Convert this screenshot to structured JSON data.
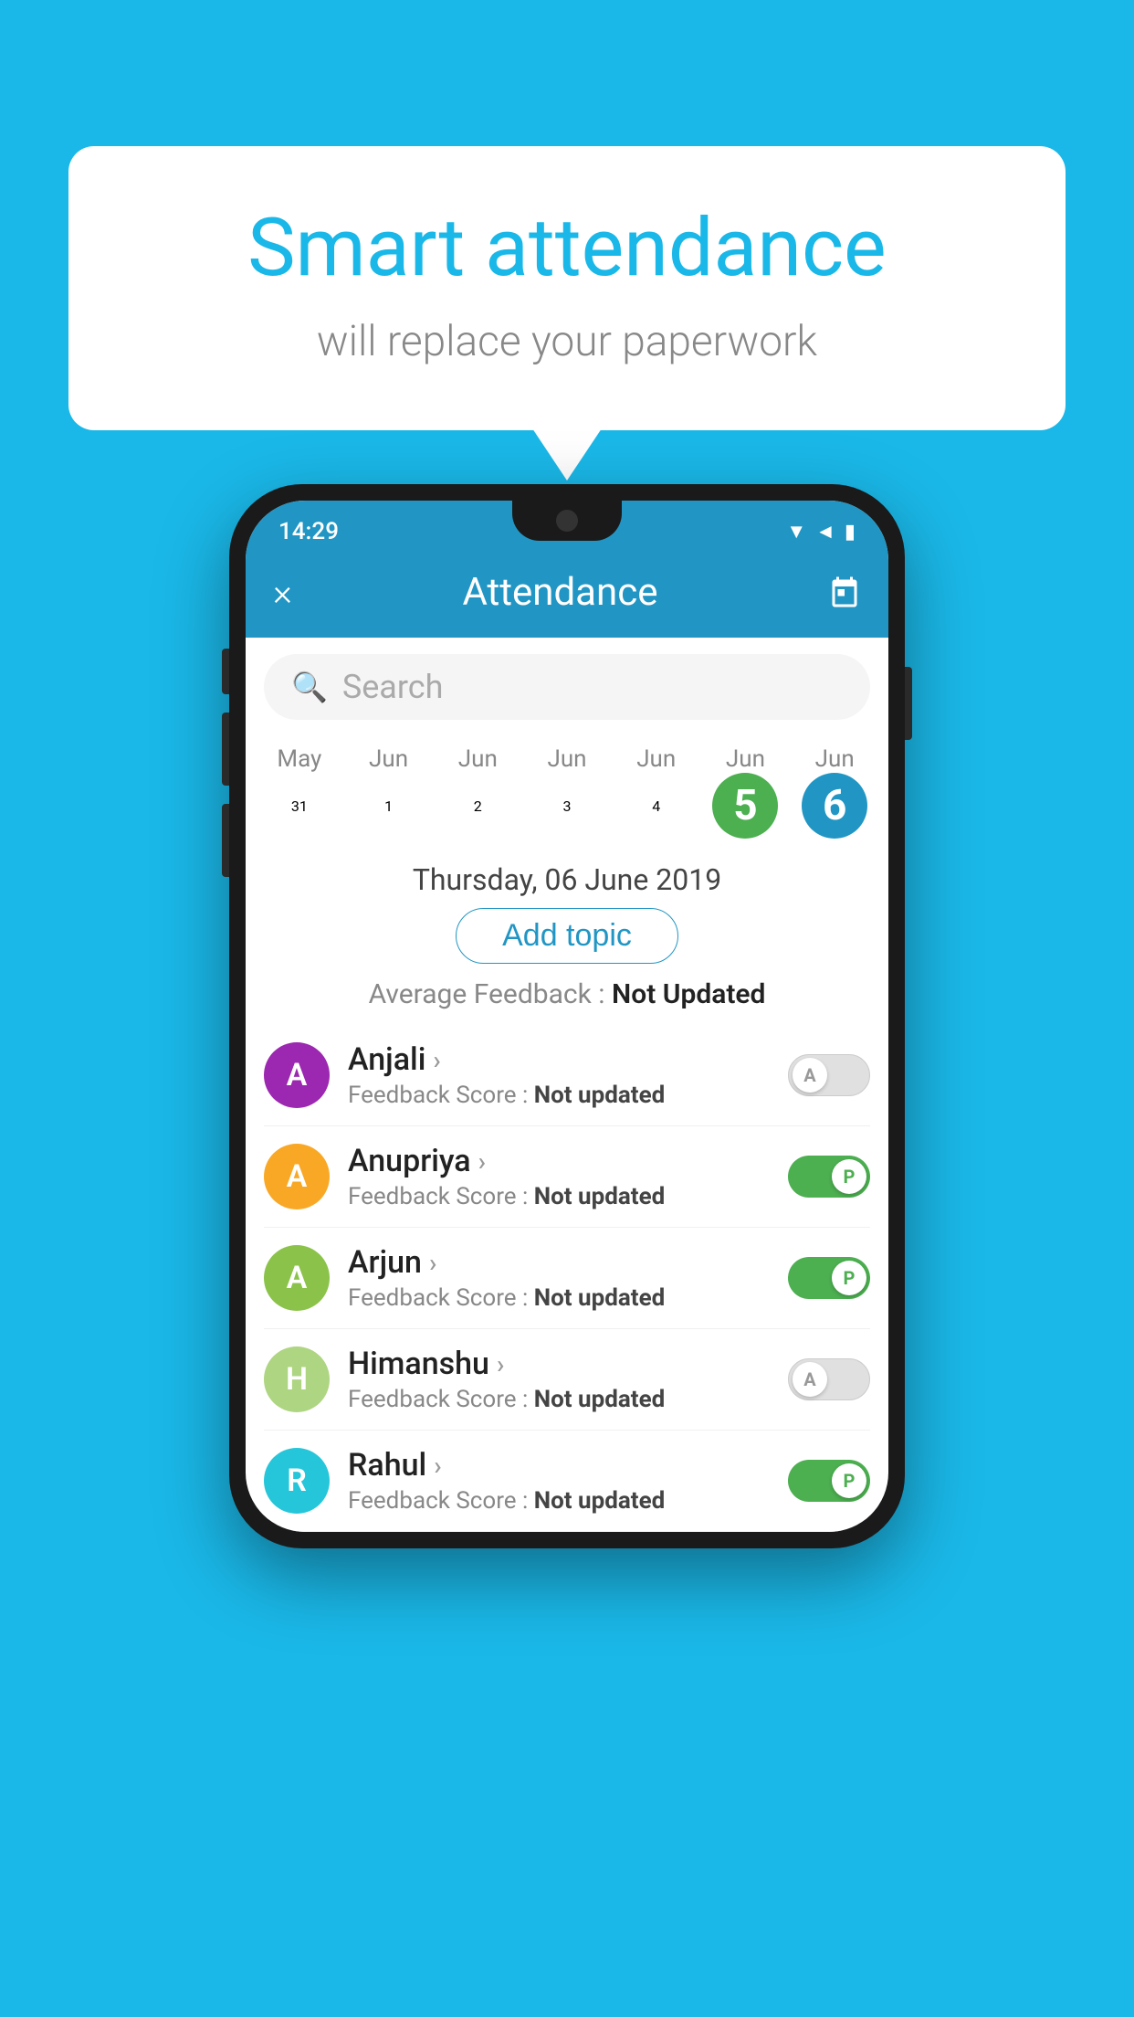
{
  "background_color": "#1ab8e8",
  "speech_bubble": {
    "title": "Smart attendance",
    "subtitle": "will replace your paperwork"
  },
  "status_bar": {
    "time": "14:29",
    "icons": [
      "wifi",
      "signal",
      "battery"
    ]
  },
  "header": {
    "close_label": "×",
    "title": "Attendance",
    "calendar_icon": "calendar"
  },
  "search": {
    "placeholder": "Search"
  },
  "dates": [
    {
      "month": "May",
      "day": "31",
      "type": "normal"
    },
    {
      "month": "Jun",
      "day": "1",
      "type": "normal"
    },
    {
      "month": "Jun",
      "day": "2",
      "type": "normal"
    },
    {
      "month": "Jun",
      "day": "3",
      "type": "normal"
    },
    {
      "month": "Jun",
      "day": "4",
      "type": "normal"
    },
    {
      "month": "Jun",
      "day": "5",
      "type": "today"
    },
    {
      "month": "Jun",
      "day": "6",
      "type": "selected"
    }
  ],
  "selected_date_label": "Thursday, 06 June 2019",
  "add_topic_label": "Add topic",
  "avg_feedback_label": "Average Feedback :",
  "avg_feedback_value": "Not Updated",
  "students": [
    {
      "name": "Anjali",
      "avatar_letter": "A",
      "avatar_color": "#9c27b0",
      "score_label": "Feedback Score :",
      "score_value": "Not updated",
      "toggle": "off",
      "toggle_letter": "A"
    },
    {
      "name": "Anupriya",
      "avatar_letter": "A",
      "avatar_color": "#f9a825",
      "score_label": "Feedback Score :",
      "score_value": "Not updated",
      "toggle": "on",
      "toggle_letter": "P"
    },
    {
      "name": "Arjun",
      "avatar_letter": "A",
      "avatar_color": "#8bc34a",
      "score_label": "Feedback Score :",
      "score_value": "Not updated",
      "toggle": "on",
      "toggle_letter": "P"
    },
    {
      "name": "Himanshu",
      "avatar_letter": "H",
      "avatar_color": "#aed581",
      "score_label": "Feedback Score :",
      "score_value": "Not updated",
      "toggle": "off",
      "toggle_letter": "A"
    },
    {
      "name": "Rahul",
      "avatar_letter": "R",
      "avatar_color": "#26c6da",
      "score_label": "Feedback Score :",
      "score_value": "Not updated",
      "toggle": "on",
      "toggle_letter": "P"
    }
  ]
}
